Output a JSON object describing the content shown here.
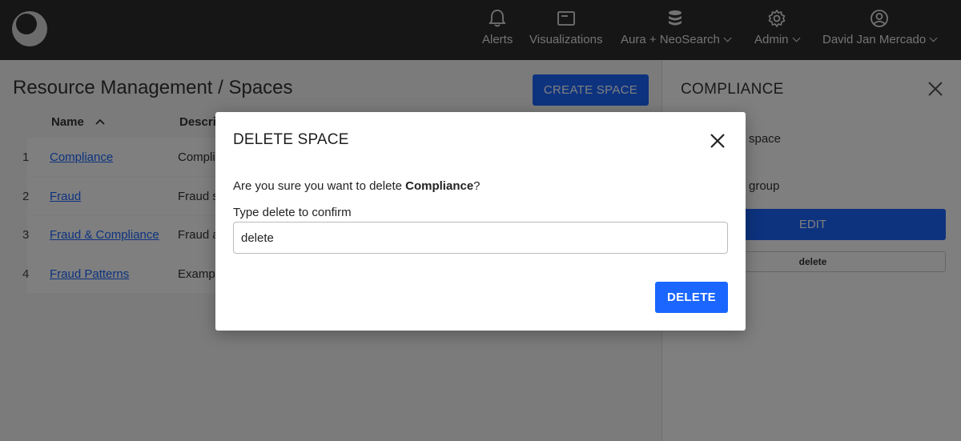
{
  "nav": {
    "items": [
      {
        "label": "Alerts",
        "icon": "bell-icon"
      },
      {
        "label": "Visualizations",
        "icon": "window-icon"
      },
      {
        "label": "Aura + NeoSearch",
        "icon": "database-icon"
      },
      {
        "label": "Admin",
        "icon": "gear-icon"
      },
      {
        "label": "David Jan Mercado",
        "icon": "user-circle-icon"
      }
    ]
  },
  "page": {
    "title": "Resource Management / Spaces",
    "create_label": "CREATE SPACE"
  },
  "table": {
    "headers": [
      "Name",
      "Descri"
    ],
    "rows": [
      {
        "num": "1",
        "name": "Compliance",
        "desc": "Compli"
      },
      {
        "num": "2",
        "name": "Fraud",
        "desc": "Fraud s"
      },
      {
        "num": "3",
        "name": "Fraud & Compliance",
        "desc": "Fraud a"
      },
      {
        "num": "4",
        "name": "Fraud Patterns",
        "desc": "Examp"
      }
    ]
  },
  "panel": {
    "title": "COMPLIANCE",
    "line1": "space",
    "line2": "group",
    "edit_label": "EDIT",
    "tag": "delete"
  },
  "modal": {
    "title": "DELETE SPACE",
    "question_prefix": "Are you sure you want to delete ",
    "question_name": "Compliance",
    "question_suffix": "?",
    "input_label": "Type delete to confirm",
    "input_value": "delete",
    "delete_label": "DELETE"
  },
  "colors": {
    "accent": "#1a66ff",
    "topbar": "#2d2d2d"
  }
}
